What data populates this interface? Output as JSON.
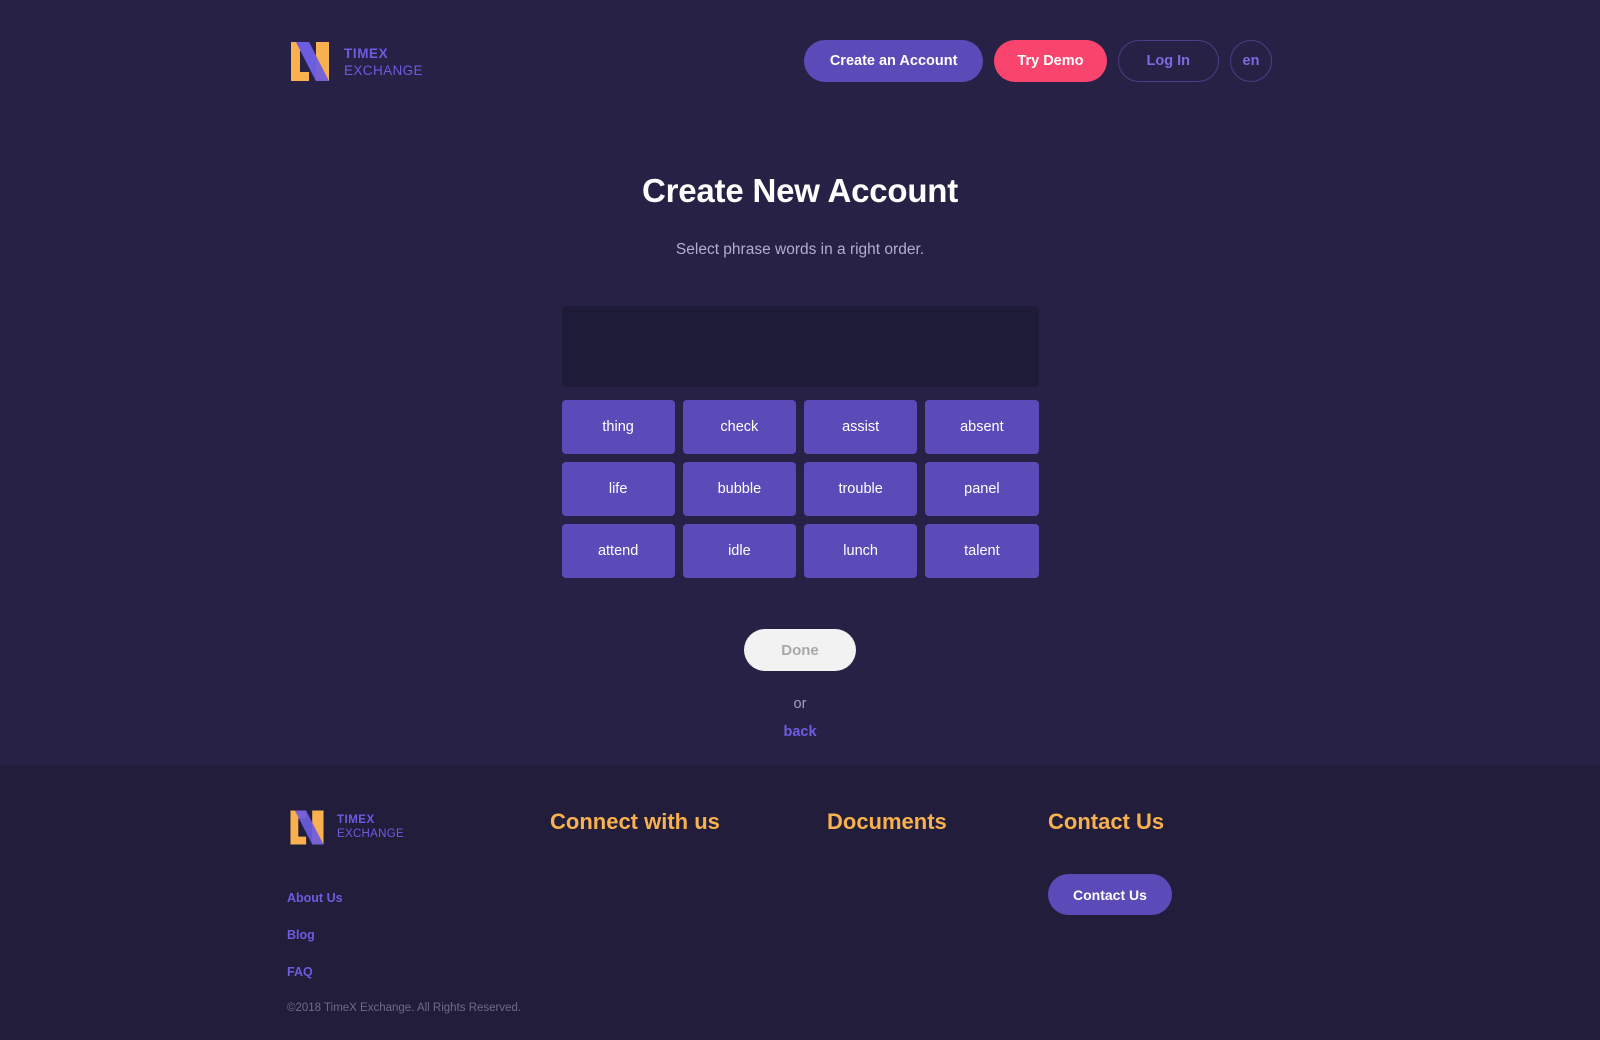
{
  "brand": {
    "line1": "TIMEX",
    "line2": "EXCHANGE",
    "logo_icon": "timex-x-logo-icon",
    "colors": {
      "orange": "#f8b14e",
      "purple": "#6c5ce0"
    }
  },
  "header": {
    "create_account_label": "Create an Account",
    "try_demo_label": "Try Demo",
    "log_in_label": "Log In",
    "language_label": "en",
    "accent_primary": "#5b4bb8",
    "accent_demo": "#f9456e"
  },
  "main": {
    "title": "Create New Account",
    "subtitle": "Select phrase words in a right order.",
    "selected_phrase": "",
    "word_tiles": [
      "thing",
      "check",
      "assist",
      "absent",
      "life",
      "bubble",
      "trouble",
      "panel",
      "attend",
      "idle",
      "lunch",
      "talent"
    ],
    "done_label": "Done",
    "or_label": "or",
    "back_label": "back"
  },
  "footer": {
    "columns": {
      "connect_heading": "Connect with us",
      "documents_heading": "Documents",
      "contact_heading": "Contact Us"
    },
    "links": [
      "About Us",
      "Blog",
      "FAQ"
    ],
    "contact_button_label": "Contact Us",
    "copyright": "©2018 TimeX Exchange. All Rights Reserved."
  }
}
